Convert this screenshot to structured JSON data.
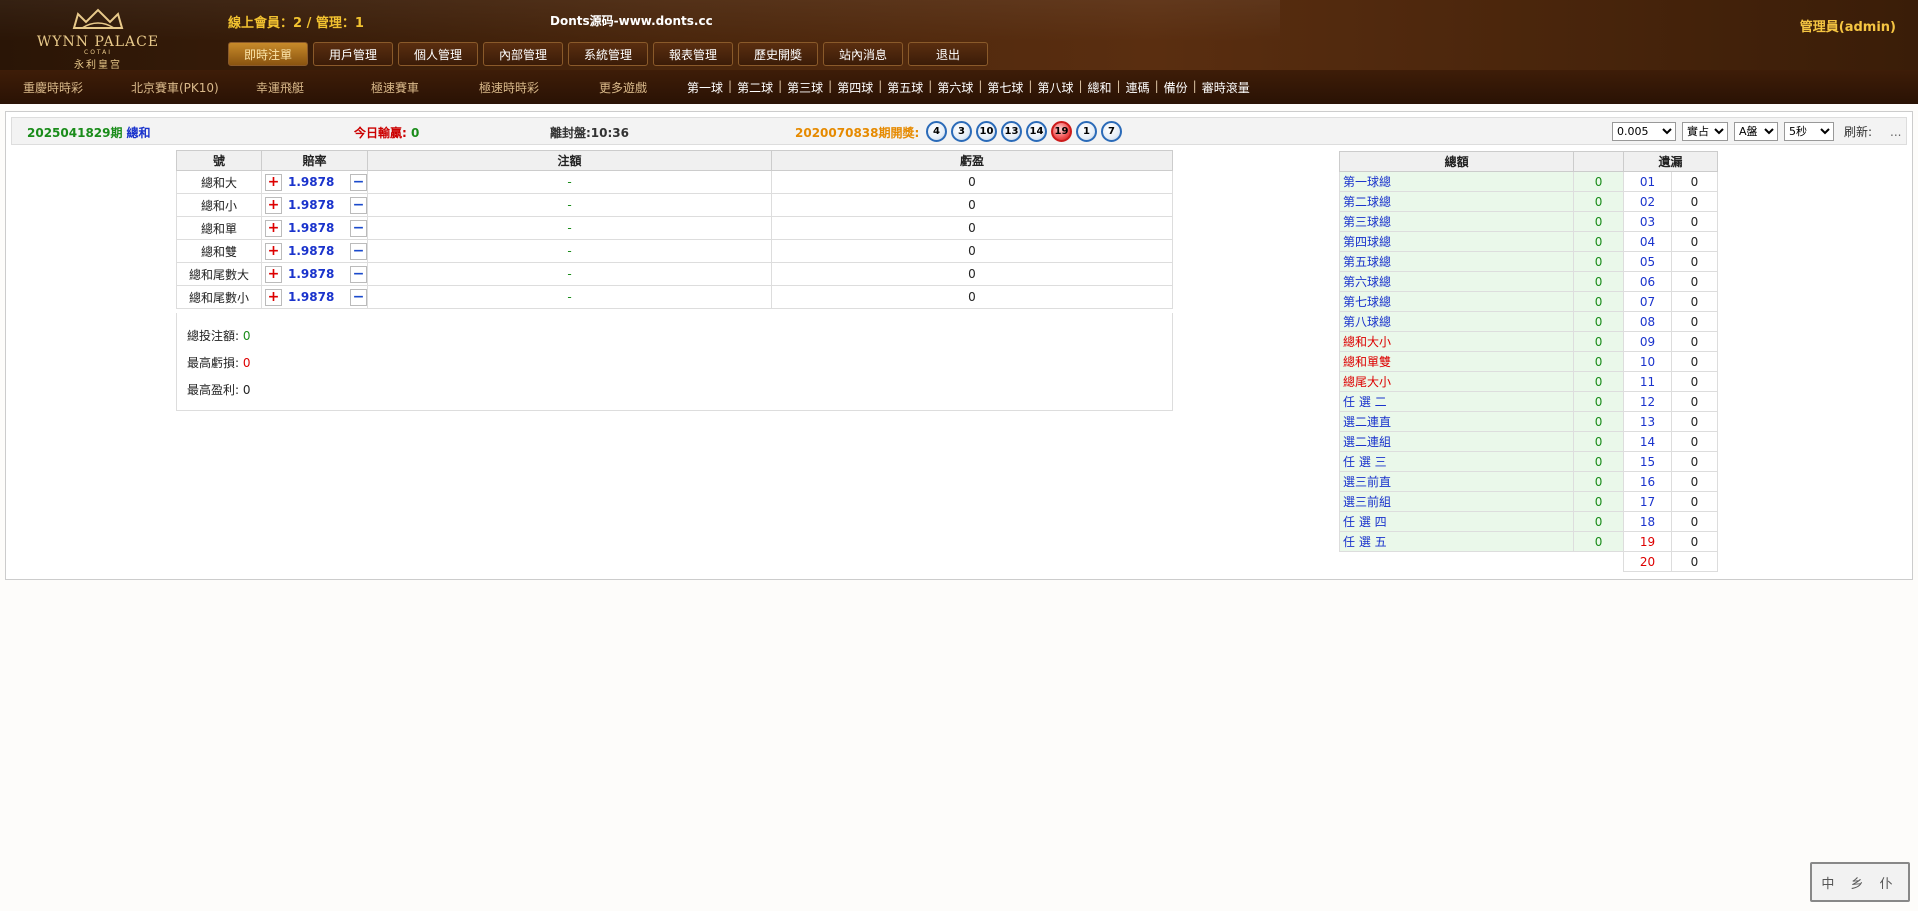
{
  "header": {
    "online_label": "線上會員：2 / 管理：1",
    "site_name": "Donts源码-www.donts.cc",
    "admin_label": "管理員(admin)",
    "logo": {
      "brand": "WYNN PALACE",
      "sub": "COTAI",
      "cn": "永利皇宫"
    }
  },
  "nav": [
    {
      "label": "即時注單",
      "active": true
    },
    {
      "label": "用戶管理"
    },
    {
      "label": "個人管理"
    },
    {
      "label": "內部管理"
    },
    {
      "label": "系統管理"
    },
    {
      "label": "報表管理"
    },
    {
      "label": "歷史開獎"
    },
    {
      "label": "站內消息"
    },
    {
      "label": "退出"
    }
  ],
  "subnav": {
    "games": [
      "重慶時時彩",
      "北京賽車(PK10)",
      "幸運飛艇",
      "極速賽車",
      "極速時時彩",
      "更多遊戲"
    ],
    "balls": [
      "第一球",
      "第二球",
      "第三球",
      "第四球",
      "第五球",
      "第六球",
      "第七球",
      "第八球",
      "總和",
      "連碼",
      "備份",
      "審時滾量"
    ]
  },
  "infobar": {
    "issue": "2025041829期",
    "issue_tag": "總和",
    "today_label": "今日輸贏:",
    "today_value": "0",
    "close_label": "離封盤:10:36",
    "draw_label": "2020070838期開獎:",
    "draw_balls": [
      {
        "n": "4"
      },
      {
        "n": "3"
      },
      {
        "n": "10"
      },
      {
        "n": "13"
      },
      {
        "n": "14"
      },
      {
        "n": "19",
        "red": true
      },
      {
        "n": "1"
      },
      {
        "n": "7"
      }
    ],
    "selects": [
      "0.005",
      "實占",
      "A盤",
      "5秒"
    ],
    "refresh_label": "刷新:",
    "refresh_dots": "..."
  },
  "bets": {
    "headers": [
      "號",
      "賠率",
      "注額",
      "虧盈"
    ],
    "rows": [
      {
        "name": "總和大",
        "odds": "1.9878",
        "amount": "-",
        "pl": "0"
      },
      {
        "name": "總和小",
        "odds": "1.9878",
        "amount": "-",
        "pl": "0"
      },
      {
        "name": "總和單",
        "odds": "1.9878",
        "amount": "-",
        "pl": "0"
      },
      {
        "name": "總和雙",
        "odds": "1.9878",
        "amount": "-",
        "pl": "0"
      },
      {
        "name": "總和尾數大",
        "odds": "1.9878",
        "amount": "-",
        "pl": "0"
      },
      {
        "name": "總和尾數小",
        "odds": "1.9878",
        "amount": "-",
        "pl": "0"
      }
    ],
    "summary": [
      {
        "label": "總投注額:",
        "value": "0",
        "cls": "g"
      },
      {
        "label": "最高虧損:",
        "value": "0",
        "cls": "r"
      },
      {
        "label": "最高盈利:",
        "value": "0",
        "cls": ""
      }
    ]
  },
  "totals": {
    "header": "總額",
    "rows": [
      {
        "name": "第一球總",
        "value": "0"
      },
      {
        "name": "第二球總",
        "value": "0"
      },
      {
        "name": "第三球總",
        "value": "0"
      },
      {
        "name": "第四球總",
        "value": "0"
      },
      {
        "name": "第五球總",
        "value": "0"
      },
      {
        "name": "第六球總",
        "value": "0"
      },
      {
        "name": "第七球總",
        "value": "0"
      },
      {
        "name": "第八球總",
        "value": "0"
      },
      {
        "name": "總和大小",
        "value": "0",
        "red": true
      },
      {
        "name": "總和單雙",
        "value": "0",
        "red": true
      },
      {
        "name": "總尾大小",
        "value": "0",
        "red": true
      },
      {
        "name": "任 選 二",
        "value": "0"
      },
      {
        "name": "選二連直",
        "value": "0"
      },
      {
        "name": "選二連組",
        "value": "0"
      },
      {
        "name": "任 選 三",
        "value": "0"
      },
      {
        "name": "選三前直",
        "value": "0"
      },
      {
        "name": "選三前組",
        "value": "0"
      },
      {
        "name": "任 選 四",
        "value": "0"
      },
      {
        "name": "任 選 五",
        "value": "0"
      }
    ]
  },
  "leaks": {
    "header": "遺漏",
    "rows": [
      {
        "num": "01",
        "cnt": "0"
      },
      {
        "num": "02",
        "cnt": "0"
      },
      {
        "num": "03",
        "cnt": "0"
      },
      {
        "num": "04",
        "cnt": "0"
      },
      {
        "num": "05",
        "cnt": "0"
      },
      {
        "num": "06",
        "cnt": "0"
      },
      {
        "num": "07",
        "cnt": "0"
      },
      {
        "num": "08",
        "cnt": "0"
      },
      {
        "num": "09",
        "cnt": "0"
      },
      {
        "num": "10",
        "cnt": "0"
      },
      {
        "num": "11",
        "cnt": "0"
      },
      {
        "num": "12",
        "cnt": "0"
      },
      {
        "num": "13",
        "cnt": "0"
      },
      {
        "num": "14",
        "cnt": "0"
      },
      {
        "num": "15",
        "cnt": "0"
      },
      {
        "num": "16",
        "cnt": "0"
      },
      {
        "num": "17",
        "cnt": "0"
      },
      {
        "num": "18",
        "cnt": "0"
      },
      {
        "num": "19",
        "cnt": "0",
        "red": true
      },
      {
        "num": "20",
        "cnt": "0",
        "red": true
      }
    ]
  },
  "corner_stamp": "中 乡 仆"
}
